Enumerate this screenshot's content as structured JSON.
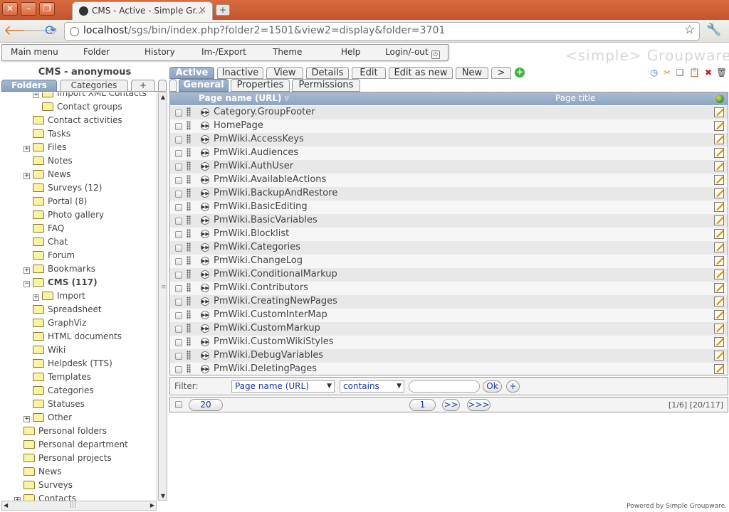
{
  "browser": {
    "tab_title": "CMS - Active - Simple Gr...",
    "tab_close": "×",
    "new_tab": "+",
    "url_host": "localhost",
    "url_path": "/sgs/bin/index.php?folder2=1501&view2=display&folder=3701"
  },
  "menu": {
    "items": [
      "Main menu",
      "Folder",
      "History",
      "Im-/Export",
      "Theme",
      "Help",
      "Login/-out"
    ],
    "brand": "<simple> Groupware"
  },
  "left": {
    "title": "CMS - anonymous",
    "tabs": [
      "Folders",
      "Categories",
      "+"
    ],
    "tree": [
      {
        "label": "Import XML Contacts",
        "exp": "+",
        "depth": 2
      },
      {
        "label": "Contact groups",
        "exp": "",
        "depth": 2
      },
      {
        "label": "Contact activities",
        "exp": "",
        "depth": 1
      },
      {
        "label": "Tasks",
        "exp": "",
        "depth": 1
      },
      {
        "label": "Files",
        "exp": "+",
        "depth": 1
      },
      {
        "label": "Notes",
        "exp": "",
        "depth": 1
      },
      {
        "label": "News",
        "exp": "+",
        "depth": 1
      },
      {
        "label": "Surveys (12)",
        "exp": "",
        "depth": 1
      },
      {
        "label": "Portal (8)",
        "exp": "",
        "depth": 1
      },
      {
        "label": "Photo gallery",
        "exp": "",
        "depth": 1
      },
      {
        "label": "FAQ",
        "exp": "",
        "depth": 1
      },
      {
        "label": "Chat",
        "exp": "",
        "depth": 1
      },
      {
        "label": "Forum",
        "exp": "",
        "depth": 1
      },
      {
        "label": "Bookmarks",
        "exp": "+",
        "depth": 1
      },
      {
        "label": "CMS (117)",
        "exp": "−",
        "depth": 1,
        "bold": true
      },
      {
        "label": "Import",
        "exp": "+",
        "depth": 2
      },
      {
        "label": "Spreadsheet",
        "exp": "",
        "depth": 1
      },
      {
        "label": "GraphViz",
        "exp": "",
        "depth": 1
      },
      {
        "label": "HTML documents",
        "exp": "",
        "depth": 1
      },
      {
        "label": "Wiki",
        "exp": "",
        "depth": 1
      },
      {
        "label": "Helpdesk (TTS)",
        "exp": "",
        "depth": 1
      },
      {
        "label": "Templates",
        "exp": "",
        "depth": 1
      },
      {
        "label": "Categories",
        "exp": "",
        "depth": 1
      },
      {
        "label": "Statuses",
        "exp": "",
        "depth": 1
      },
      {
        "label": "Other",
        "exp": "+",
        "depth": 1
      },
      {
        "label": "Personal folders",
        "exp": "",
        "depth": 0
      },
      {
        "label": "Personal department",
        "exp": "",
        "depth": 0
      },
      {
        "label": "Personal projects",
        "exp": "",
        "depth": 0
      },
      {
        "label": "News",
        "exp": "",
        "depth": 0
      },
      {
        "label": "Surveys",
        "exp": "",
        "depth": 0
      },
      {
        "label": "Contacts",
        "exp": "+",
        "depth": 0
      }
    ]
  },
  "views": {
    "tabs": [
      "Active",
      "Inactive",
      "View",
      "Details",
      "Edit",
      "Edit as new",
      "New",
      ">"
    ],
    "subtabs": [
      "General",
      "Properties",
      "Permissions"
    ]
  },
  "grid": {
    "col_name": "Page name (URL) ▿",
    "col_title": "Page title",
    "rows": [
      "Category.GroupFooter",
      "HomePage",
      "PmWiki.AccessKeys",
      "PmWiki.Audiences",
      "PmWiki.AuthUser",
      "PmWiki.AvailableActions",
      "PmWiki.BackupAndRestore",
      "PmWiki.BasicEditing",
      "PmWiki.BasicVariables",
      "PmWiki.Blocklist",
      "PmWiki.Categories",
      "PmWiki.ChangeLog",
      "PmWiki.ConditionalMarkup",
      "PmWiki.Contributors",
      "PmWiki.CreatingNewPages",
      "PmWiki.CustomInterMap",
      "PmWiki.CustomMarkup",
      "PmWiki.CustomWikiStyles",
      "PmWiki.DebugVariables",
      "PmWiki.DeletingPages"
    ]
  },
  "filter": {
    "label": "Filter:",
    "field": "Page name (URL)",
    "op": "contains",
    "value": "",
    "ok": "Ok",
    "add": "+"
  },
  "pager": {
    "page_size": "20",
    "page": "1",
    "next": ">>",
    "last": ">>>",
    "info": "[1/6] [20/117]"
  },
  "footer": "Powered by Simple Groupware."
}
